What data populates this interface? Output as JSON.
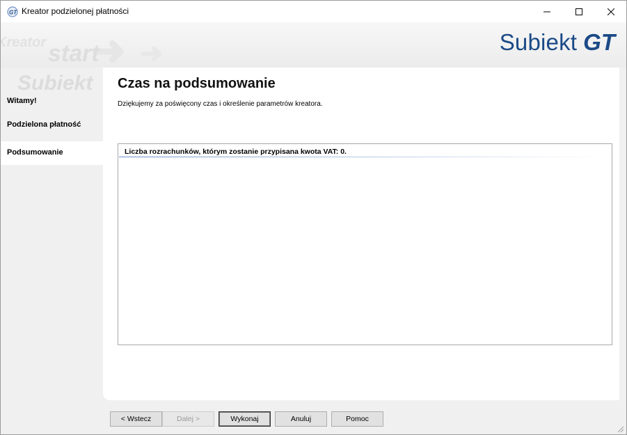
{
  "window": {
    "title": "Kreator podzielonej płatności"
  },
  "banner": {
    "watermark_kreator": "Kreator",
    "watermark_start": "start",
    "watermark_subiekt": "Subiekt",
    "logo_word": "Subiekt",
    "logo_suffix": "GT",
    "logo_color": "#1b4a86"
  },
  "sidebar": {
    "items": [
      {
        "label": "Witamy!",
        "active": false
      },
      {
        "label": "Podzielona płatność",
        "active": false
      },
      {
        "label": "Podsumowanie",
        "active": true
      }
    ]
  },
  "main": {
    "heading": "Czas na podsumowanie",
    "subtitle": "Dziękujemy za poświęcony czas i określenie parametrów kreatora.",
    "summary_lines": [
      "Liczba rozrachunków, którym zostanie przypisana kwota VAT: 0."
    ]
  },
  "buttons": {
    "back": "< Wstecz",
    "next": "Dalej >",
    "execute": "Wykonaj",
    "cancel": "Anuluj",
    "help": "Pomoc"
  },
  "icons": {
    "app": "subiekt-gt-app-icon",
    "minimize": "minimize-icon",
    "maximize": "maximize-icon",
    "close": "close-icon",
    "resize": "resize-grip-icon"
  }
}
